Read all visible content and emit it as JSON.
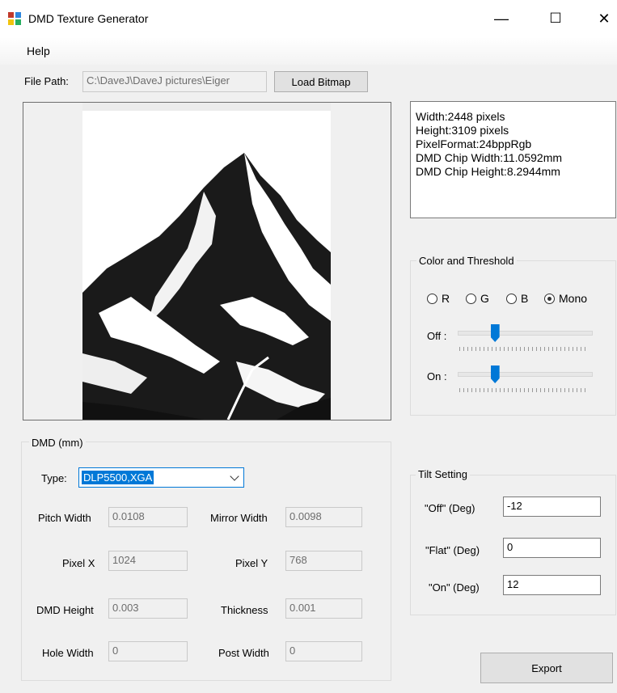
{
  "window": {
    "title": "DMD Texture Generator",
    "minimize": "—",
    "maximize": "☐",
    "close": "✕"
  },
  "menu": {
    "help": "Help"
  },
  "file": {
    "label": "File Path:",
    "value": "C:\\DaveJ\\DaveJ pictures\\Eiger",
    "load_button": "Load Bitmap"
  },
  "info": [
    "Width:2448 pixels",
    "Height:3109 pixels",
    "PixelFormat:24bppRgb",
    "DMD Chip Width:11.0592mm",
    "DMD Chip Height:8.2944mm"
  ],
  "color_threshold": {
    "title": "Color and Threshold",
    "options": [
      "R",
      "G",
      "B",
      "Mono"
    ],
    "selected": "Mono",
    "off_label": "Off :",
    "on_label": "On :",
    "off_level": 0.28,
    "on_level": 0.28
  },
  "dmd": {
    "title": "DMD (mm)",
    "type_label": "Type:",
    "type_value": "DLP5500,XGA",
    "fields": {
      "pitch_width": {
        "label": "Pitch Width",
        "value": "0.0108"
      },
      "mirror_width": {
        "label": "Mirror Width",
        "value": "0.0098"
      },
      "pixel_x": {
        "label": "Pixel X",
        "value": "1024"
      },
      "pixel_y": {
        "label": "Pixel Y",
        "value": "768"
      },
      "dmd_height": {
        "label": "DMD Height",
        "value": "0.003"
      },
      "thickness": {
        "label": "Thickness",
        "value": "0.001"
      },
      "hole_width": {
        "label": "Hole Width",
        "value": "0"
      },
      "post_width": {
        "label": "Post Width",
        "value": "0"
      }
    }
  },
  "tilt": {
    "title": "Tilt Setting",
    "off_label": "\"Off\" (Deg)",
    "off_value": "-12",
    "flat_label": "\"Flat\" (Deg)",
    "flat_value": "0",
    "on_label": "\"On\" (Deg)",
    "on_value": "12"
  },
  "export_button": "Export",
  "colors": {
    "accent": "#0078d7",
    "window_bg": "#f0f0f0"
  }
}
